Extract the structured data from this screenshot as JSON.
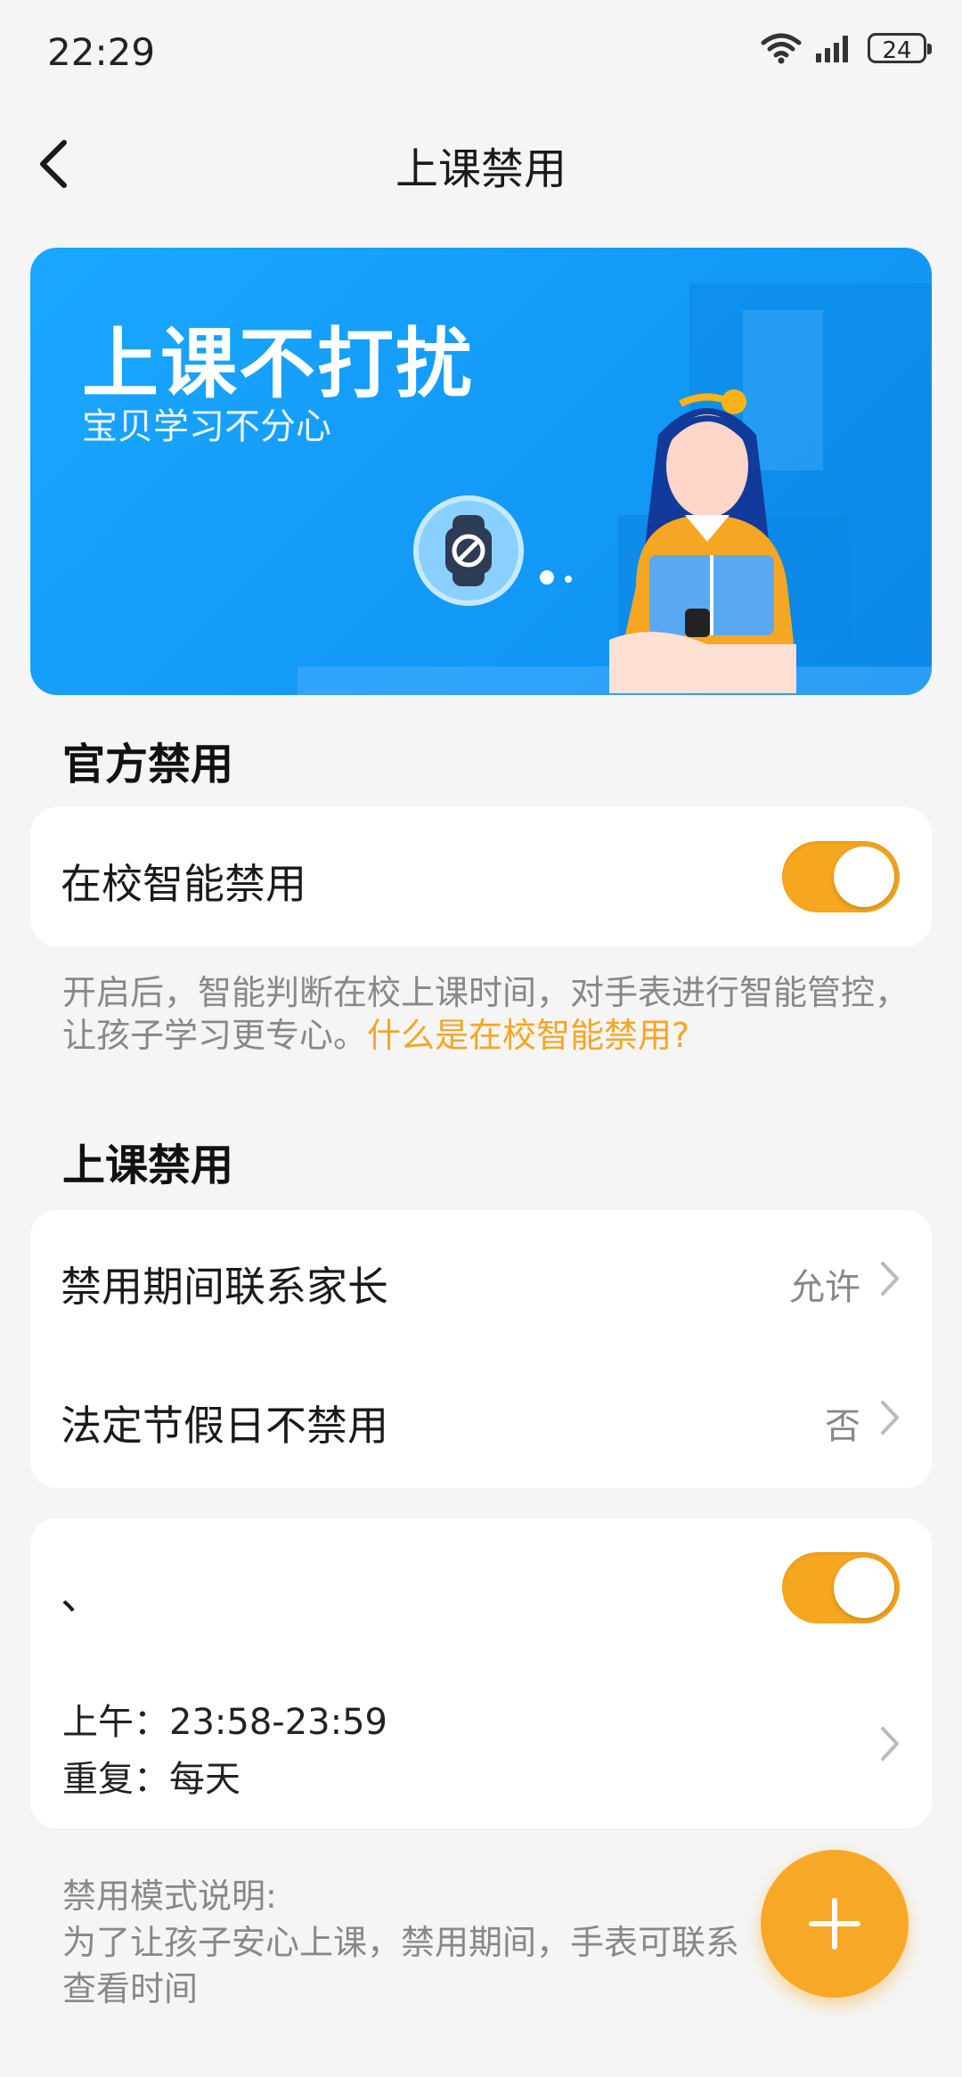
{
  "status": {
    "time": "22:29",
    "battery": "24"
  },
  "header": {
    "title": "上课禁用"
  },
  "banner": {
    "title": "上课不打扰",
    "subtitle": "宝贝学习不分心"
  },
  "official": {
    "section_title": "官方禁用",
    "smart_label": "在校智能禁用",
    "smart_enabled": true,
    "desc_text": "开启后，智能判断在校上课时间，对手表进行智能管控，让孩子学习更专心。",
    "desc_link": "什么是在校智能禁用?"
  },
  "class": {
    "section_title": "上课禁用",
    "contact_label": "禁用期间联系家长",
    "contact_value": "允许",
    "holiday_label": "法定节假日不禁用",
    "holiday_value": "否"
  },
  "schedule": {
    "name": "、",
    "enabled": true,
    "time_line": "上午：23:58-23:59",
    "repeat_line": "重复：每天"
  },
  "notes": {
    "title": "禁用模式说明:",
    "line1": "为了让孩子安心上课，禁用期间，手表可联系",
    "line2": "查看时间"
  },
  "colors": {
    "accent": "#f7a61f",
    "banner": "#1aa7ff"
  }
}
